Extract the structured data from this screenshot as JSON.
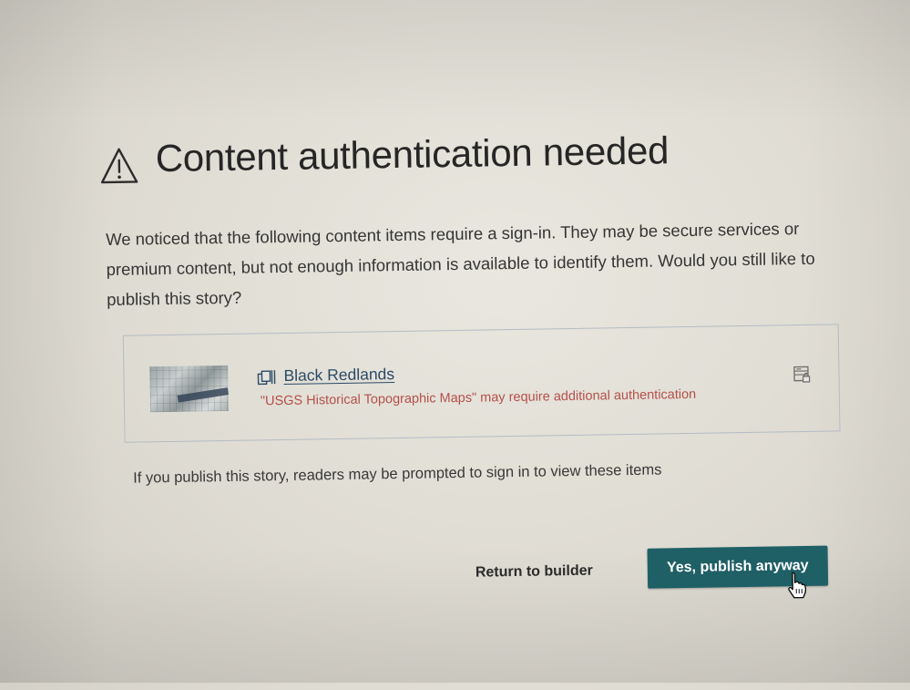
{
  "dialog": {
    "title": "Content authentication needed",
    "description": "We noticed that the following content items require a sign-in. They may be secure services or premium content, but not enough information is available to identify them. Would you still like to publish this story?",
    "items": [
      {
        "title": "Black Redlands",
        "warning": "\"USGS Historical Topographic Maps\" may require additional authentication",
        "type_icon": "map-layer-icon",
        "status_icon": "secure-service-icon"
      }
    ],
    "note": "If you publish this story, readers may be prompted to sign in to view these items",
    "buttons": {
      "return_label": "Return to builder",
      "publish_label": "Yes, publish anyway"
    }
  },
  "colors": {
    "primary_button": "#1f5f66",
    "warning_text": "#b4504a",
    "link_text": "#2a4a66",
    "card_border": "#b4bcc4"
  }
}
